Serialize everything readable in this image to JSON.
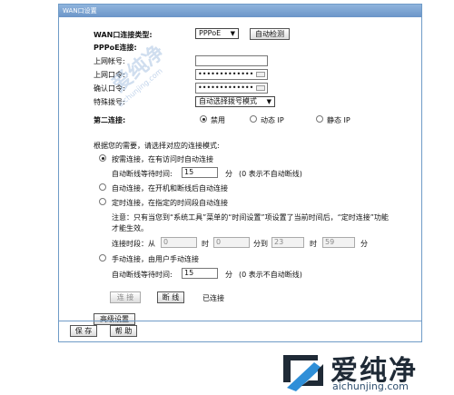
{
  "window": {
    "title": "WAN口设置"
  },
  "wan": {
    "type_label": "WAN口连接类型:",
    "type_value": "PPPoE",
    "autodetect_label": "自动检测",
    "pppoe_heading": "PPPoE连接:",
    "account_label": "上网帐号:",
    "account_value": "",
    "password_label": "上网口令:",
    "password_value": "•••••••••••••",
    "confirm_label": "确认口令:",
    "confirm_value": "•••••••••••••",
    "dial_label": "特殊拨号:",
    "dial_value": "自动选择拨号模式"
  },
  "second_connection": {
    "label": "第二连接:",
    "options": [
      "禁用",
      "动态 IP",
      "静态 IP"
    ],
    "selected": "禁用"
  },
  "mode": {
    "prompt": "根据您的需要，请选择对应的连接模式:",
    "on_demand": "按需连接，在有访问时自动连接",
    "on_demand_idle_label": "自动断线等待时间:",
    "on_demand_idle_value": "15",
    "on_demand_unit": "分",
    "on_demand_hint": "(0 表示不自动断线)",
    "auto": "自动连接，在开机和断线后自动连接",
    "scheduled": "定时连接，在指定的时间段自动连接",
    "scheduled_note": "注意：只有当您到“系统工具”菜单的“时间设置”项设置了当前时间后，“定时连接”功能才能生效。",
    "period_label": "连接时段：从",
    "from_hour": "0",
    "hour_unit": "时",
    "from_min": "0",
    "to_label": "分到",
    "to_hour": "23",
    "to_min": "59",
    "min_unit": "分",
    "manual": "手动连接，由用户手动连接",
    "manual_idle_label": "自动断线等待时间:",
    "manual_idle_value": "15",
    "manual_unit": "分",
    "manual_hint": "(0 表示不自动断线)",
    "selected": "on_demand"
  },
  "actions": {
    "connect": "连 接",
    "disconnect": "断 线",
    "status": "已连接",
    "advanced": "高级设置"
  },
  "footer": {
    "save": "保 存",
    "help": "帮 助"
  },
  "watermark": {
    "brand": "爱纯净",
    "url": "aichunjing.com"
  }
}
